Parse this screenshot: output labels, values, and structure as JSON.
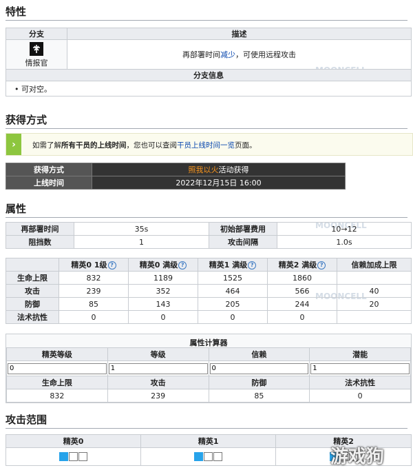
{
  "traits": {
    "heading": "特性",
    "col_branch": "分支",
    "col_desc": "描述",
    "branch_name": "情报官",
    "desc_before": "再部署时间",
    "desc_link": "减少",
    "desc_after": "，可使用远程攻击",
    "branch_info_header": "分支信息",
    "branch_info_item": "可对空。"
  },
  "acquire": {
    "heading": "获得方式",
    "notice_before": "如需了解",
    "notice_bold": "所有干员的上线时间",
    "notice_mid": "，您也可以查阅",
    "notice_link": "干员上线时间一览",
    "notice_after": "页面。",
    "method_label": "获得方式",
    "method_link": "照我以火",
    "method_suffix": "活动获得",
    "online_label": "上线时间",
    "online_value": "2022年12月15日 16:00"
  },
  "attrs": {
    "heading": "属性",
    "redeploy_label": "再部署时间",
    "redeploy_value": "35s",
    "cost_label": "初始部署费用",
    "cost_value": "10→12",
    "block_label": "阻挡数",
    "block_value": "1",
    "interval_label": "攻击间隔",
    "interval_value": "1.0s"
  },
  "stats": {
    "headers": [
      "精英0 1级",
      "精英0 满级",
      "精英1 满级",
      "精英2 满级",
      "信赖加成上限"
    ],
    "help_glyph": "?",
    "rows": [
      {
        "label": "生命上限",
        "values": [
          "832",
          "1189",
          "1525",
          "1860"
        ],
        "trust": ""
      },
      {
        "label": "攻击",
        "values": [
          "239",
          "352",
          "464",
          "566"
        ],
        "trust": "40"
      },
      {
        "label": "防御",
        "values": [
          "85",
          "143",
          "205",
          "244"
        ],
        "trust": "20"
      },
      {
        "label": "法术抗性",
        "values": [
          "0",
          "0",
          "0",
          "0"
        ],
        "trust": ""
      }
    ]
  },
  "calc": {
    "title": "属性计算器",
    "labels": [
      "精英等级",
      "等级",
      "信赖",
      "潜能"
    ],
    "inputs": [
      "0",
      "1",
      "0",
      "1"
    ],
    "out_labels": [
      "生命上限",
      "攻击",
      "防御",
      "法术抗性"
    ],
    "out_values": [
      "832",
      "239",
      "85",
      "0"
    ]
  },
  "range": {
    "heading": "攻击范围",
    "cols": [
      "精英0",
      "精英1",
      "精英2"
    ]
  },
  "watermark": {
    "text": "MOONCELL",
    "site": "游戏狗"
  },
  "colors": {
    "notice_accent": "#8dc63f",
    "dark_header": "#555555",
    "dark_cell": "#333333",
    "range_fill": "#27a3ea",
    "link": "#0645ad",
    "event_link": "#f7941d"
  }
}
